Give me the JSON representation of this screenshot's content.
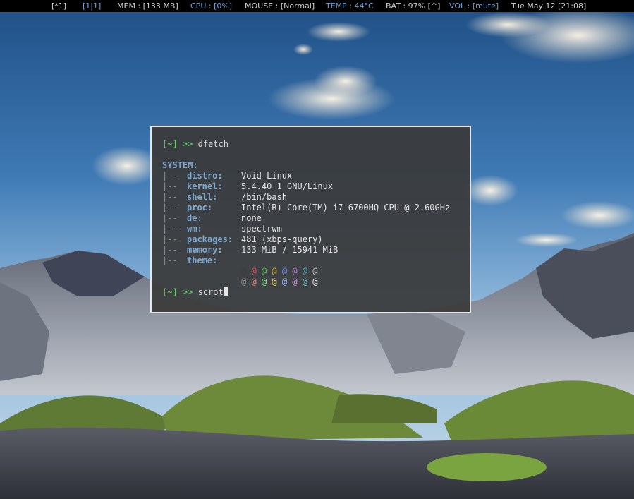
{
  "statusbar": {
    "workspace": "[*1]",
    "region": "[1|1]",
    "mem": "MEM : [133 MB]",
    "cpu": "CPU : [0%]",
    "mouse": "MOUSE : [Normal]",
    "temp": "TEMP : 44°C",
    "bat": "BAT : 97% [^]",
    "vol": "VOL : [mute]",
    "clock": "Tue May 12 [21:08]"
  },
  "terminal": {
    "prompt": "[~] >>",
    "command1": "dfetch",
    "section": "SYSTEM:",
    "tree": "|--",
    "rows": [
      {
        "key": "distro:",
        "value": "Void Linux"
      },
      {
        "key": "kernel:",
        "value": "5.4.40_1 GNU/Linux"
      },
      {
        "key": "shell:",
        "value": "/bin/bash"
      },
      {
        "key": "proc:",
        "value": "Intel(R) Core(TM) i7-6700HQ CPU @ 2.60GHz"
      },
      {
        "key": "de:",
        "value": "none"
      },
      {
        "key": "wm:",
        "value": "spectrwm"
      },
      {
        "key": "packages:",
        "value": "481 (xbps-query)"
      },
      {
        "key": "memory:",
        "value": "133 MiB / 15941 MiB"
      },
      {
        "key": "theme:",
        "value": ""
      }
    ],
    "swatch_glyph": "@",
    "palette_dark": [
      "#3a3a3a",
      "#e05a5a",
      "#52c452",
      "#c8b04a",
      "#7a8fd8",
      "#b07ad0",
      "#5fb8c0",
      "#d0d0d0"
    ],
    "palette_light": [
      "#8a8a8a",
      "#ff7a7a",
      "#7af07a",
      "#f0d870",
      "#9aaef0",
      "#d09af0",
      "#7ad8e0",
      "#ffffff"
    ],
    "command2": "scrot"
  }
}
